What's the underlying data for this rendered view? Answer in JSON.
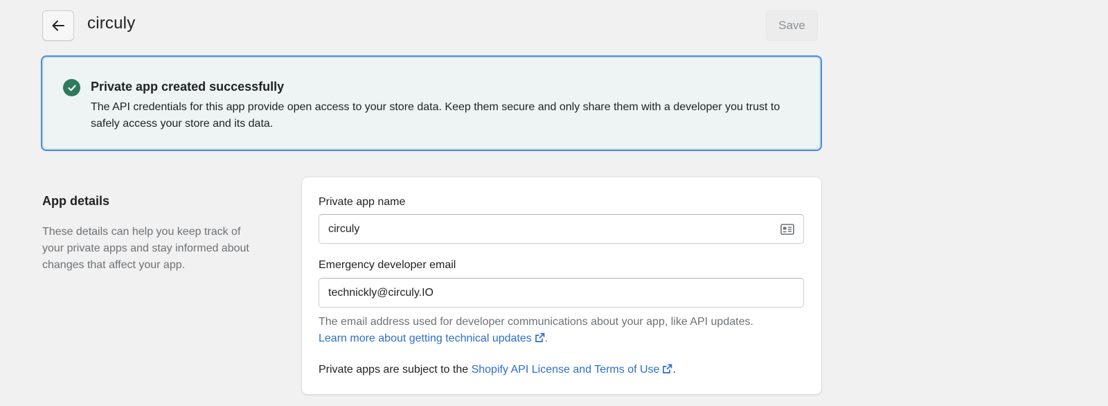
{
  "header": {
    "title": "circuly",
    "save_label": "Save"
  },
  "banner": {
    "title": "Private app created successfully",
    "body": "The API credentials for this app provide open access to your store data. Keep them secure and only share them with a developer you trust to safely access your store and its data.",
    "status_color": "#2d7a5e"
  },
  "section": {
    "title": "App details",
    "description": "These details can help you keep track of your private apps and stay informed about changes that affect your app."
  },
  "form": {
    "app_name_label": "Private app name",
    "app_name_value": "circuly",
    "email_label": "Emergency developer email",
    "email_value": "technickly@circuly.IO",
    "email_help": "The email address used for developer communications about your app, like API updates.",
    "email_help_link": "Learn more about getting technical updates",
    "email_help_link_suffix": ".",
    "terms_prefix": "Private apps are subject to the ",
    "terms_link": "Shopify API License and Terms of Use",
    "terms_suffix": "."
  },
  "icons": {
    "back": "arrow-left-icon",
    "success": "checkmark-circle-icon",
    "contact_card": "contact-card-icon",
    "external_link": "external-link-icon"
  },
  "colors": {
    "link": "#2c6ecb",
    "focus_ring": "#4a84e8"
  }
}
